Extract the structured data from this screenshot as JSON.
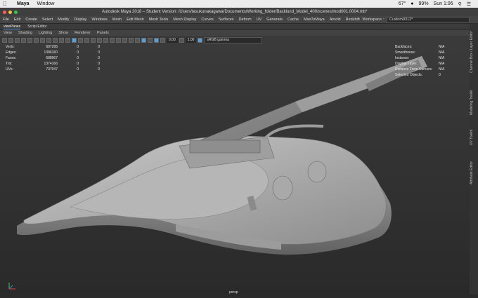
{
  "mac_menu": {
    "app": "Maya",
    "window": "Window",
    "battery": "99%",
    "time": "Sun 1:06",
    "temp": "67°"
  },
  "window_title": "Autodesk Maya 2018 – Student Version: /Users/tasukunakagawa/Documents/Working_folder/Backlund_Model_400/scenes/mod001.0004.mb*",
  "main_menu": [
    "File",
    "Edit",
    "Create",
    "Select",
    "Modify",
    "Display",
    "Windows",
    "Mesh",
    "Edit Mesh",
    "Mesh Tools",
    "Mesh Display",
    "Curves",
    "Surfaces",
    "Deform",
    "UV",
    "Generate",
    "Cache",
    "MaxToMaya",
    "Arnold",
    "Redshift"
  ],
  "workspace": {
    "label": "Workspace :",
    "value": "Custom0312*"
  },
  "panel_tabs": [
    "viewPanes",
    "Script Editor"
  ],
  "viewport_menu": [
    "View",
    "Shading",
    "Lighting",
    "Show",
    "Renderer",
    "Panels"
  ],
  "toolbar": {
    "exposure": "0.00",
    "gamma_value": "1.00",
    "color_space": "sRGB gamma"
  },
  "hud_left": [
    {
      "k": "Verts:",
      "a": "697295",
      "b": "0",
      "c": "0"
    },
    {
      "k": "Edges:",
      "a": "1386160",
      "b": "0",
      "c": "0"
    },
    {
      "k": "Faces:",
      "a": "688967",
      "b": "0",
      "c": "0"
    },
    {
      "k": "Tris:",
      "a": "1374166",
      "b": "0",
      "c": "0"
    },
    {
      "k": "UVs:",
      "a": "737047",
      "b": "0",
      "c": "0"
    }
  ],
  "hud_right": [
    {
      "k": "Backfaces:",
      "v": "N/A"
    },
    {
      "k": "Smoothness:",
      "v": "N/A"
    },
    {
      "k": "Instance:",
      "v": "N/A"
    },
    {
      "k": "Display Layer:",
      "v": "N/A"
    },
    {
      "k": "Distance From Camera:",
      "v": "N/A"
    },
    {
      "k": "Selected Objects:",
      "v": "0"
    }
  ],
  "camera": "persp",
  "side_tabs": [
    "Channel Box / Layer Editor",
    "Modeling Toolkit",
    "UV Toolkit",
    "Attribute Editor"
  ]
}
